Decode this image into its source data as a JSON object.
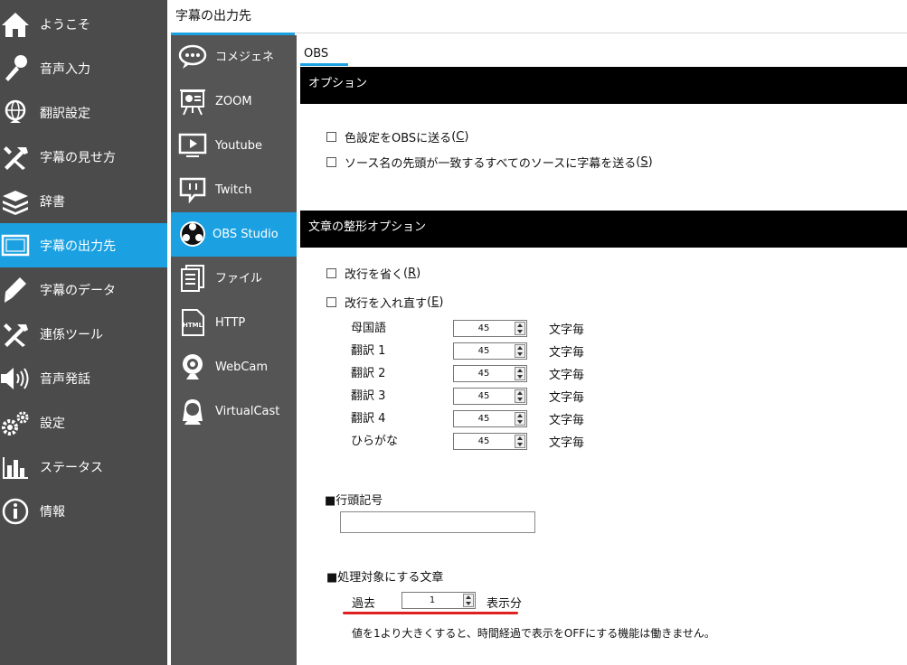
{
  "sidebar": {
    "items": [
      {
        "label": "ようこそ",
        "icon": "home-icon"
      },
      {
        "label": "音声入力",
        "icon": "microphone-icon"
      },
      {
        "label": "翻訳設定",
        "icon": "globe-icon"
      },
      {
        "label": "字幕の見せ方",
        "icon": "tools-icon"
      },
      {
        "label": "辞書",
        "icon": "books-icon"
      },
      {
        "label": "字幕の出力先",
        "icon": "monitor-icon",
        "active": true
      },
      {
        "label": "字幕のデータ",
        "icon": "pen-icon"
      },
      {
        "label": "連係ツール",
        "icon": "tools-icon"
      },
      {
        "label": "音声発話",
        "icon": "speaker-icon"
      },
      {
        "label": "設定",
        "icon": "gears-icon"
      },
      {
        "label": "ステータス",
        "icon": "bar-chart-icon"
      },
      {
        "label": "情報",
        "icon": "info-icon"
      }
    ]
  },
  "header": {
    "title": "字幕の出力先"
  },
  "subnav": {
    "items": [
      {
        "label": "コメジェネ",
        "icon": "speech-bubble-icon"
      },
      {
        "label": "ZOOM",
        "icon": "presentation-icon"
      },
      {
        "label": "Youtube",
        "icon": "play-screen-icon"
      },
      {
        "label": "Twitch",
        "icon": "twitch-icon"
      },
      {
        "label": "OBS Studio",
        "icon": "obs-icon",
        "active": true
      },
      {
        "label": "ファイル",
        "icon": "file-icon"
      },
      {
        "label": "HTTP",
        "icon": "html-file-icon"
      },
      {
        "label": "WebCam",
        "icon": "webcam-icon"
      },
      {
        "label": "VirtualCast",
        "icon": "avatar-icon"
      }
    ]
  },
  "main": {
    "tab": "OBS",
    "options": {
      "title": "オプション",
      "checkboxes": [
        {
          "label": "色設定をOBSに送る",
          "key": "C",
          "checked": false
        },
        {
          "label": "ソース名の先頭が一致するすべてのソースに字幕を送る",
          "key": "S",
          "checked": false
        }
      ]
    },
    "format": {
      "title": "文章の整形オプション",
      "checkboxes": [
        {
          "label": "改行を省く",
          "key": "R",
          "checked": false
        },
        {
          "label": "改行を入れ直す",
          "key": "E",
          "checked": false
        }
      ],
      "unit": "文字毎",
      "rows": [
        {
          "label": "母国語",
          "value": "45"
        },
        {
          "label": "翻訳 1",
          "value": "45"
        },
        {
          "label": "翻訳 2",
          "value": "45"
        },
        {
          "label": "翻訳 3",
          "value": "45"
        },
        {
          "label": "翻訳 4",
          "value": "45"
        },
        {
          "label": "ひらがな",
          "value": "45"
        }
      ]
    },
    "line_prefix": {
      "label": "■行頭記号",
      "value": ""
    },
    "target": {
      "label": "■処理対象にする文章",
      "past_label": "過去",
      "value": "1",
      "suffix": "表示分",
      "note": "値を1より大きくすると、時間経過で表示をOFFにする機能は働きません。"
    }
  },
  "colors": {
    "accent": "#1ba1e2",
    "sidebar_bg": "#4b4b4b",
    "subnav_bg": "#555555",
    "highlight": "#e02020"
  }
}
